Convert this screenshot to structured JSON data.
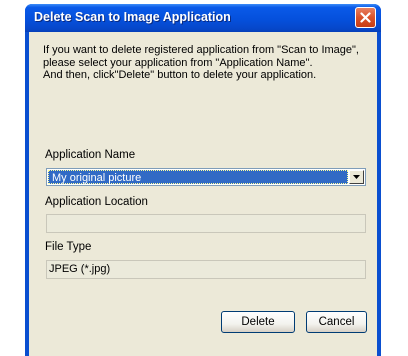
{
  "window": {
    "title": "Delete Scan to Image Application"
  },
  "description": {
    "line1": "If you want to delete registered application from \"Scan to Image\", please select your application from \"Application Name\".",
    "line2": "And then, click\"Delete\" button to delete your application."
  },
  "application_name": {
    "label": "Application Name",
    "selected": "My original picture"
  },
  "application_location": {
    "label": "Application Location",
    "value": ""
  },
  "file_type": {
    "label": "File Type",
    "value": "JPEG (*.jpg)"
  },
  "buttons": {
    "delete_label": "Delete",
    "cancel_label": "Cancel"
  },
  "icons": {
    "close": "close-icon",
    "dropdown": "chevron-down-icon"
  },
  "colors": {
    "titlebar": "#0550dc",
    "selection": "#316ac5",
    "dialog_face": "#ece9d8",
    "close_button": "#d9522a"
  }
}
